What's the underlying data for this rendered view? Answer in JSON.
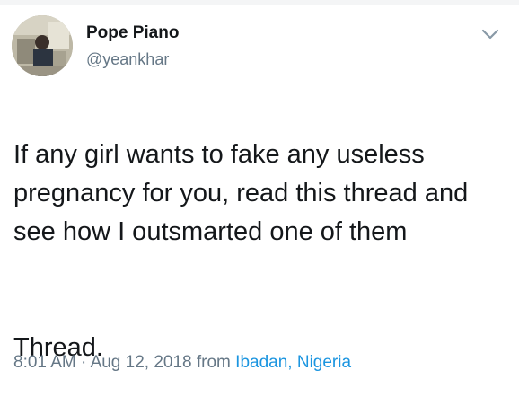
{
  "user": {
    "display_name": "Pope Piano",
    "handle": "@yeankhar"
  },
  "tweet": {
    "text_main": "If any girl wants to fake any useless pregnancy for you, read this thread and see how I outsmarted one of them",
    "text_thread": "Thread."
  },
  "meta": {
    "time": "8:01 AM",
    "separator": " · ",
    "date": "Aug 12, 2018",
    "from_label": " from ",
    "location": "Ibadan, Nigeria"
  },
  "icons": {
    "avatar": "profile-photo",
    "caret": "chevron-down-icon"
  },
  "colors": {
    "name": "#14171a",
    "secondary": "#657786",
    "link": "#1b95e0",
    "background": "#ffffff"
  }
}
